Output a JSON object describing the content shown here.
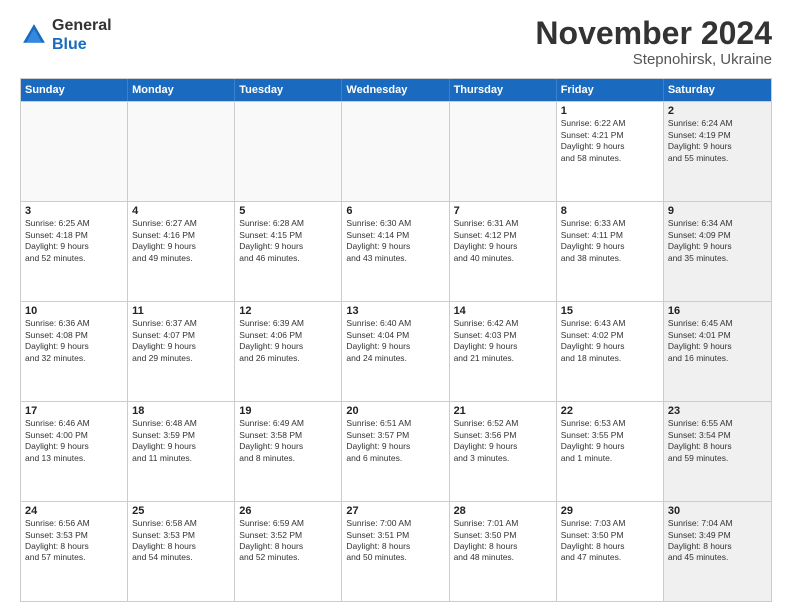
{
  "logo": {
    "general": "General",
    "blue": "Blue"
  },
  "title": "November 2024",
  "location": "Stepnohirsk, Ukraine",
  "header_days": [
    "Sunday",
    "Monday",
    "Tuesday",
    "Wednesday",
    "Thursday",
    "Friday",
    "Saturday"
  ],
  "rows": [
    [
      {
        "day": "",
        "info": ""
      },
      {
        "day": "",
        "info": ""
      },
      {
        "day": "",
        "info": ""
      },
      {
        "day": "",
        "info": ""
      },
      {
        "day": "",
        "info": ""
      },
      {
        "day": "1",
        "info": "Sunrise: 6:22 AM\nSunset: 4:21 PM\nDaylight: 9 hours\nand 58 minutes."
      },
      {
        "day": "2",
        "info": "Sunrise: 6:24 AM\nSunset: 4:19 PM\nDaylight: 9 hours\nand 55 minutes."
      }
    ],
    [
      {
        "day": "3",
        "info": "Sunrise: 6:25 AM\nSunset: 4:18 PM\nDaylight: 9 hours\nand 52 minutes."
      },
      {
        "day": "4",
        "info": "Sunrise: 6:27 AM\nSunset: 4:16 PM\nDaylight: 9 hours\nand 49 minutes."
      },
      {
        "day": "5",
        "info": "Sunrise: 6:28 AM\nSunset: 4:15 PM\nDaylight: 9 hours\nand 46 minutes."
      },
      {
        "day": "6",
        "info": "Sunrise: 6:30 AM\nSunset: 4:14 PM\nDaylight: 9 hours\nand 43 minutes."
      },
      {
        "day": "7",
        "info": "Sunrise: 6:31 AM\nSunset: 4:12 PM\nDaylight: 9 hours\nand 40 minutes."
      },
      {
        "day": "8",
        "info": "Sunrise: 6:33 AM\nSunset: 4:11 PM\nDaylight: 9 hours\nand 38 minutes."
      },
      {
        "day": "9",
        "info": "Sunrise: 6:34 AM\nSunset: 4:09 PM\nDaylight: 9 hours\nand 35 minutes."
      }
    ],
    [
      {
        "day": "10",
        "info": "Sunrise: 6:36 AM\nSunset: 4:08 PM\nDaylight: 9 hours\nand 32 minutes."
      },
      {
        "day": "11",
        "info": "Sunrise: 6:37 AM\nSunset: 4:07 PM\nDaylight: 9 hours\nand 29 minutes."
      },
      {
        "day": "12",
        "info": "Sunrise: 6:39 AM\nSunset: 4:06 PM\nDaylight: 9 hours\nand 26 minutes."
      },
      {
        "day": "13",
        "info": "Sunrise: 6:40 AM\nSunset: 4:04 PM\nDaylight: 9 hours\nand 24 minutes."
      },
      {
        "day": "14",
        "info": "Sunrise: 6:42 AM\nSunset: 4:03 PM\nDaylight: 9 hours\nand 21 minutes."
      },
      {
        "day": "15",
        "info": "Sunrise: 6:43 AM\nSunset: 4:02 PM\nDaylight: 9 hours\nand 18 minutes."
      },
      {
        "day": "16",
        "info": "Sunrise: 6:45 AM\nSunset: 4:01 PM\nDaylight: 9 hours\nand 16 minutes."
      }
    ],
    [
      {
        "day": "17",
        "info": "Sunrise: 6:46 AM\nSunset: 4:00 PM\nDaylight: 9 hours\nand 13 minutes."
      },
      {
        "day": "18",
        "info": "Sunrise: 6:48 AM\nSunset: 3:59 PM\nDaylight: 9 hours\nand 11 minutes."
      },
      {
        "day": "19",
        "info": "Sunrise: 6:49 AM\nSunset: 3:58 PM\nDaylight: 9 hours\nand 8 minutes."
      },
      {
        "day": "20",
        "info": "Sunrise: 6:51 AM\nSunset: 3:57 PM\nDaylight: 9 hours\nand 6 minutes."
      },
      {
        "day": "21",
        "info": "Sunrise: 6:52 AM\nSunset: 3:56 PM\nDaylight: 9 hours\nand 3 minutes."
      },
      {
        "day": "22",
        "info": "Sunrise: 6:53 AM\nSunset: 3:55 PM\nDaylight: 9 hours\nand 1 minute."
      },
      {
        "day": "23",
        "info": "Sunrise: 6:55 AM\nSunset: 3:54 PM\nDaylight: 8 hours\nand 59 minutes."
      }
    ],
    [
      {
        "day": "24",
        "info": "Sunrise: 6:56 AM\nSunset: 3:53 PM\nDaylight: 8 hours\nand 57 minutes."
      },
      {
        "day": "25",
        "info": "Sunrise: 6:58 AM\nSunset: 3:53 PM\nDaylight: 8 hours\nand 54 minutes."
      },
      {
        "day": "26",
        "info": "Sunrise: 6:59 AM\nSunset: 3:52 PM\nDaylight: 8 hours\nand 52 minutes."
      },
      {
        "day": "27",
        "info": "Sunrise: 7:00 AM\nSunset: 3:51 PM\nDaylight: 8 hours\nand 50 minutes."
      },
      {
        "day": "28",
        "info": "Sunrise: 7:01 AM\nSunset: 3:50 PM\nDaylight: 8 hours\nand 48 minutes."
      },
      {
        "day": "29",
        "info": "Sunrise: 7:03 AM\nSunset: 3:50 PM\nDaylight: 8 hours\nand 47 minutes."
      },
      {
        "day": "30",
        "info": "Sunrise: 7:04 AM\nSunset: 3:49 PM\nDaylight: 8 hours\nand 45 minutes."
      }
    ]
  ]
}
